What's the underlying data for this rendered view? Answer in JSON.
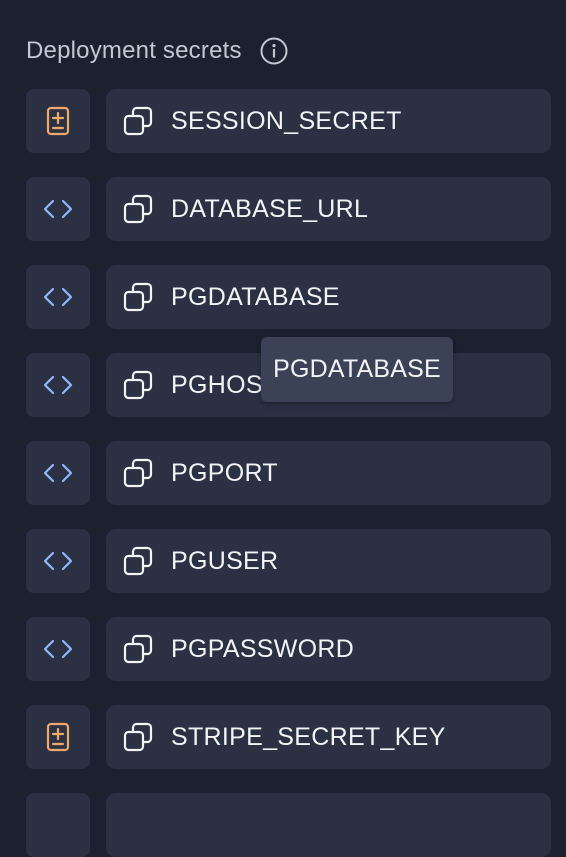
{
  "header": {
    "title": "Deployment secrets",
    "info_icon": "info-icon"
  },
  "colors": {
    "background": "#1c2130",
    "row_background": "#2b3143",
    "env_icon": "#f0a868",
    "code_icon": "#8fb8ff",
    "text": "#f2f3f6",
    "tooltip_background": "#3b4256"
  },
  "secrets": [
    {
      "name": "SESSION_SECRET",
      "type_icon": "env-file-icon"
    },
    {
      "name": "DATABASE_URL",
      "type_icon": "code-icon"
    },
    {
      "name": "PGDATABASE",
      "type_icon": "code-icon"
    },
    {
      "name": "PGHOST",
      "type_icon": "code-icon"
    },
    {
      "name": "PGPORT",
      "type_icon": "code-icon"
    },
    {
      "name": "PGUSER",
      "type_icon": "code-icon"
    },
    {
      "name": "PGPASSWORD",
      "type_icon": "code-icon"
    },
    {
      "name": "STRIPE_SECRET_KEY",
      "type_icon": "env-file-icon"
    },
    {
      "name": "",
      "type_icon": ""
    }
  ],
  "tooltip": {
    "text": "PGDATABASE"
  }
}
